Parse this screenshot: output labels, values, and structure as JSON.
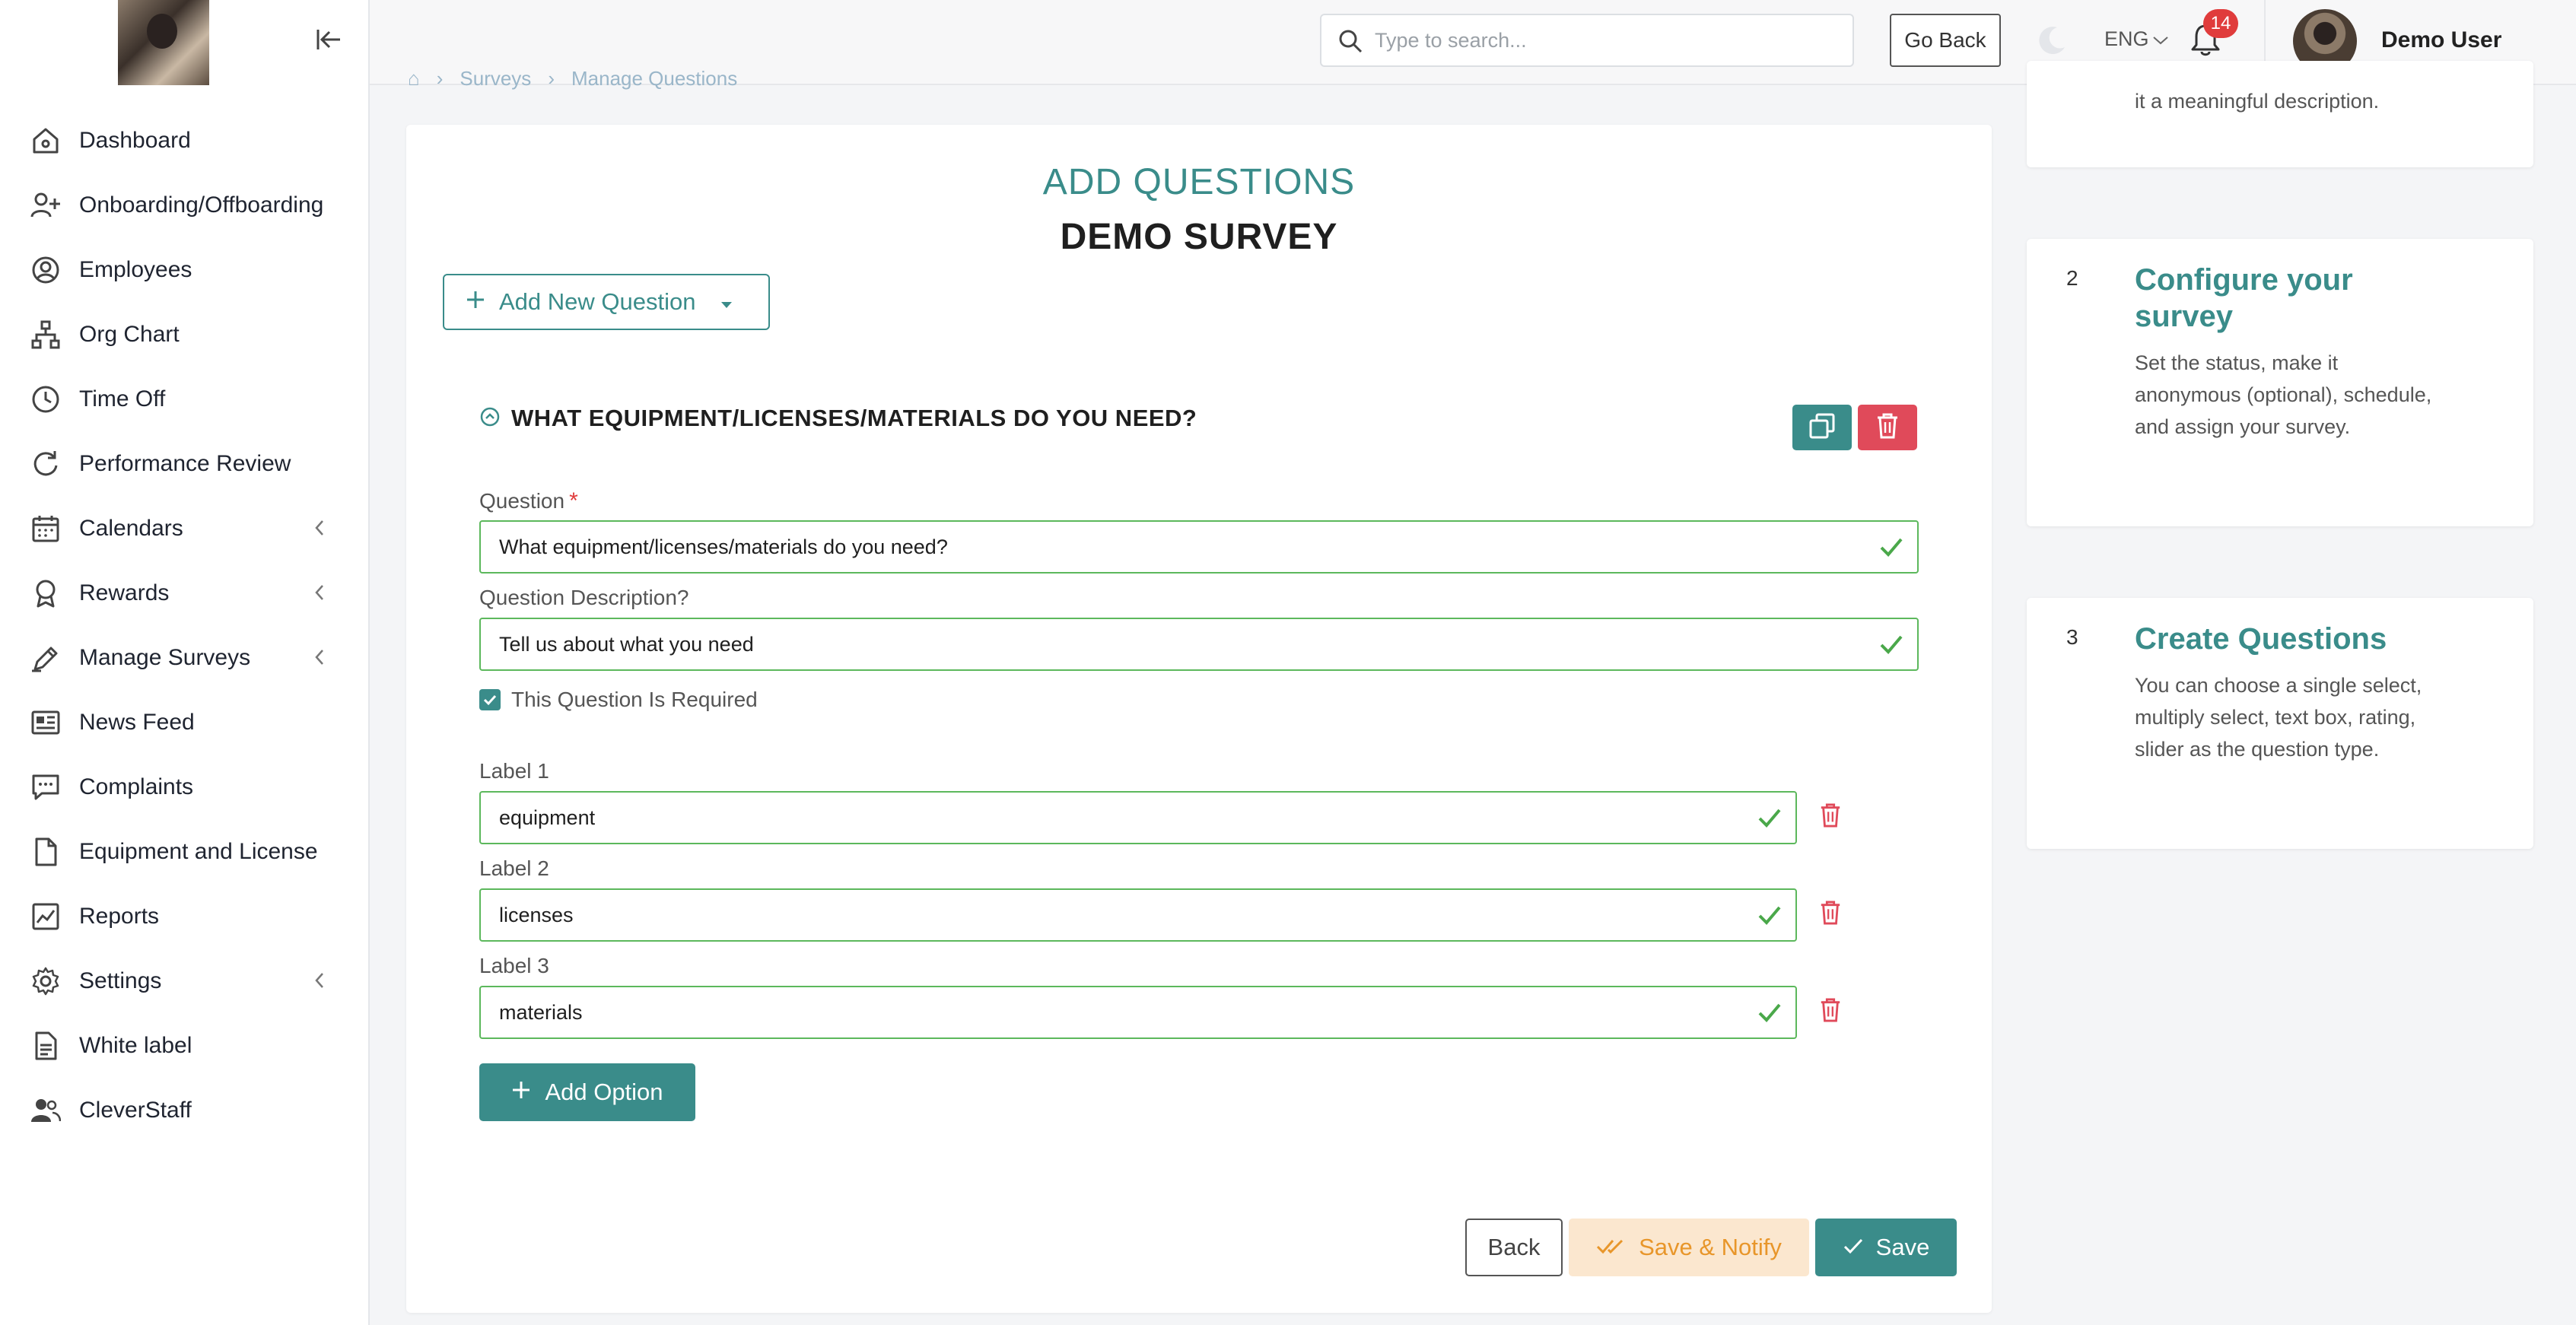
{
  "sidebar": {
    "items": [
      {
        "label": "Dashboard",
        "icon": "home-icon"
      },
      {
        "label": "Onboarding/Offboarding",
        "icon": "user-plus-icon"
      },
      {
        "label": "Employees",
        "icon": "user-circle-icon"
      },
      {
        "label": "Org Chart",
        "icon": "org-chart-icon"
      },
      {
        "label": "Time Off",
        "icon": "clock-icon"
      },
      {
        "label": "Performance Review",
        "icon": "refresh-icon"
      },
      {
        "label": "Calendars",
        "icon": "calendar-icon",
        "expandable": true
      },
      {
        "label": "Rewards",
        "icon": "award-icon",
        "expandable": true
      },
      {
        "label": "Manage Surveys",
        "icon": "pen-icon",
        "expandable": true
      },
      {
        "label": "News Feed",
        "icon": "newspaper-icon"
      },
      {
        "label": "Complaints",
        "icon": "message-icon"
      },
      {
        "label": "Equipment and License",
        "icon": "file-icon"
      },
      {
        "label": "Reports",
        "icon": "chart-icon"
      },
      {
        "label": "Settings",
        "icon": "gear-icon",
        "expandable": true
      },
      {
        "label": "White label",
        "icon": "document-icon"
      },
      {
        "label": "CleverStaff",
        "icon": "users-icon"
      }
    ]
  },
  "topbar": {
    "search_placeholder": "Type to search...",
    "go_back": "Go Back",
    "lang": "ENG",
    "notifications": "14",
    "user_name": "Demo User"
  },
  "breadcrumb": {
    "items": [
      "Surveys",
      "Manage Questions"
    ]
  },
  "main": {
    "title": "ADD QUESTIONS",
    "survey_name": "DEMO SURVEY",
    "add_new_question": "Add New Question",
    "question_header": "WHAT EQUIPMENT/LICENSES/MATERIALS DO YOU NEED?",
    "question_label": "Question",
    "question_required_mark": "*",
    "question_value": "What equipment/licenses/materials do you need?",
    "description_label": "Question Description?",
    "description_value": "Tell us about what you need",
    "required_checkbox": "This Question Is Required",
    "options": [
      {
        "label": "Label 1",
        "value": "equipment"
      },
      {
        "label": "Label 2",
        "value": "licenses"
      },
      {
        "label": "Label 3",
        "value": "materials"
      }
    ],
    "add_option": "Add Option",
    "back": "Back",
    "save_notify": "Save & Notify",
    "save": "Save"
  },
  "steps": [
    {
      "number": "",
      "title": "",
      "desc": "it a meaningful description."
    },
    {
      "number": "2",
      "title": "Configure your survey",
      "desc": "Set the status, make it anonymous (optional), schedule, and assign your survey."
    },
    {
      "number": "3",
      "title": "Create Questions",
      "desc": "You can choose a single select, multiply select, text box, rating, slider as the question type."
    }
  ],
  "colors": {
    "accent": "#3a8c8a",
    "danger": "#e04a5a",
    "valid": "#5cb85c",
    "notify_bg": "#fbe7cf",
    "notify_text": "#e8962a"
  }
}
